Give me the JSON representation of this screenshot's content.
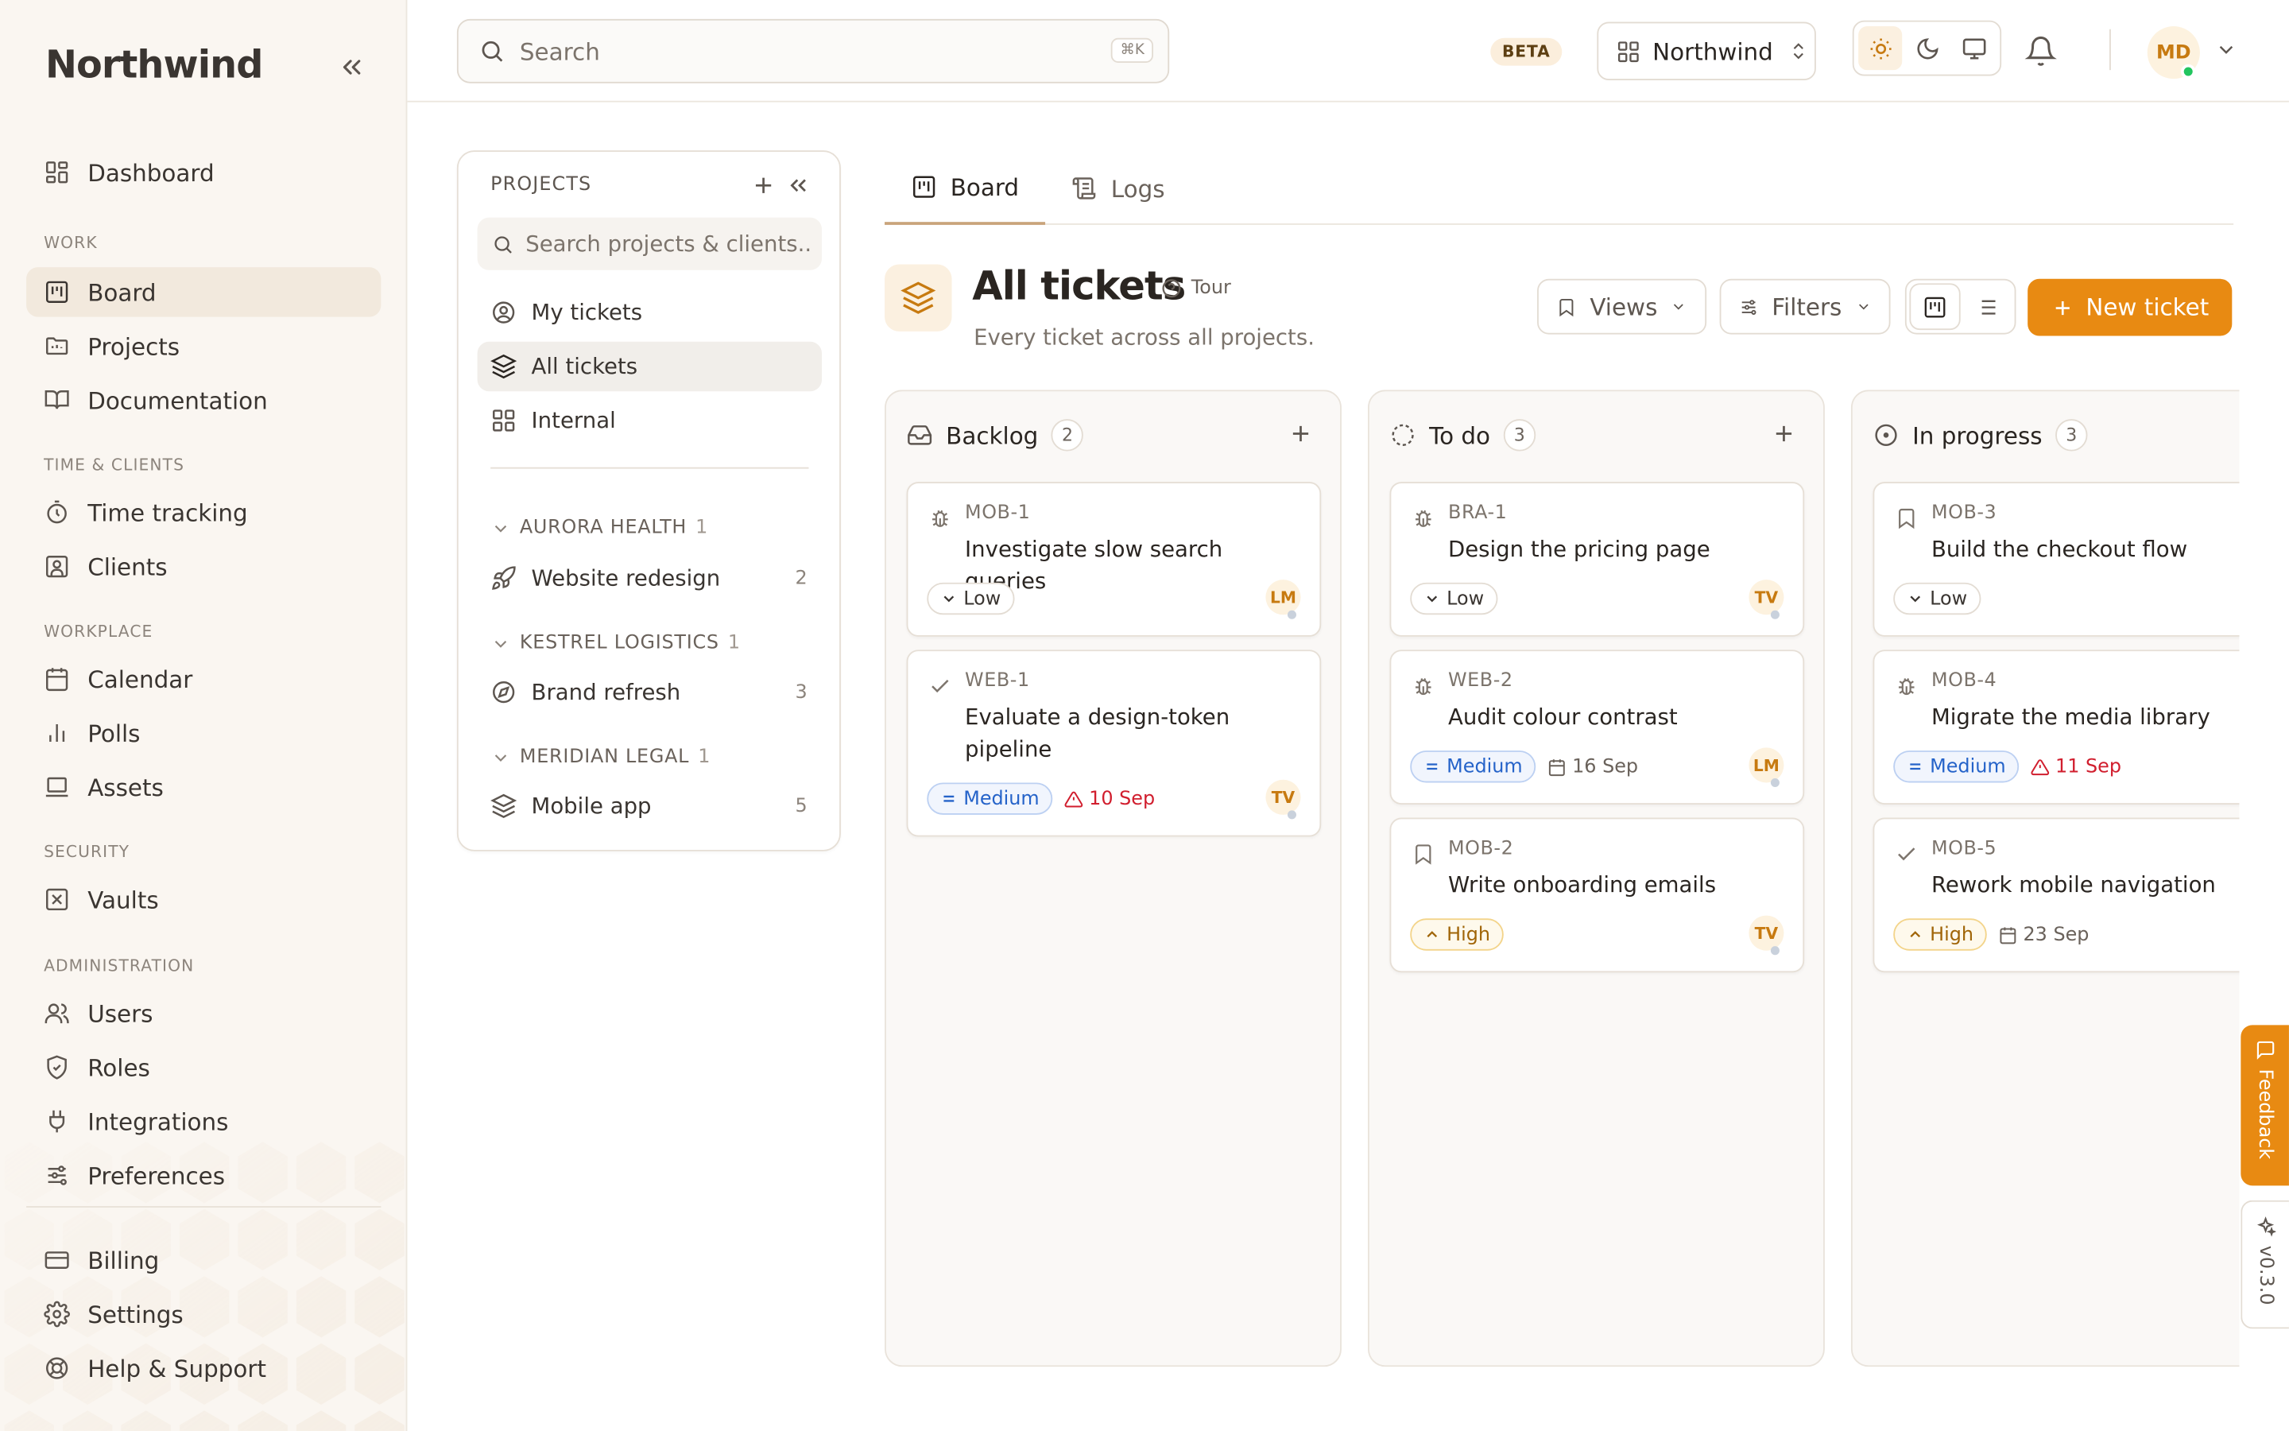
{
  "sidebar": {
    "brand": "Northwind",
    "items": {
      "dashboard": "Dashboard",
      "board": "Board",
      "projects": "Projects",
      "documentation": "Documentation",
      "time_tracking": "Time tracking",
      "clients": "Clients",
      "calendar": "Calendar",
      "polls": "Polls",
      "assets": "Assets",
      "vaults": "Vaults",
      "users": "Users",
      "roles": "Roles",
      "integrations": "Integrations",
      "preferences": "Preferences",
      "billing": "Billing",
      "settings": "Settings",
      "help": "Help & Support"
    },
    "sections": {
      "work": "WORK",
      "time_clients": "TIME & CLIENTS",
      "workplace": "WORKPLACE",
      "security": "SECURITY",
      "administration": "ADMINISTRATION"
    }
  },
  "topbar": {
    "search_placeholder": "Search",
    "search_shortcut": "⌘K",
    "beta": "BETA",
    "workspace": "Northwind",
    "avatar_initials": "MD"
  },
  "projects_panel": {
    "title": "PROJECTS",
    "search_placeholder": "Search projects & clients...",
    "my_tickets": "My tickets",
    "all_tickets": "All tickets",
    "internal": "Internal",
    "clients": [
      {
        "name": "AURORA HEALTH",
        "count": "1",
        "project": "Website redesign",
        "project_count": "2"
      },
      {
        "name": "KESTREL LOGISTICS",
        "count": "1",
        "project": "Brand refresh",
        "project_count": "3"
      },
      {
        "name": "MERIDIAN LEGAL",
        "count": "1",
        "project": "Mobile app",
        "project_count": "5"
      }
    ]
  },
  "main": {
    "tabs": {
      "board": "Board",
      "logs": "Logs"
    },
    "title": "All tickets",
    "tour": "Tour",
    "subtitle": "Every ticket across all projects.",
    "views": "Views",
    "filters": "Filters",
    "new_ticket": "New ticket"
  },
  "board": {
    "columns": [
      {
        "name": "Backlog",
        "count": "2",
        "cards": [
          {
            "id": "MOB-1",
            "title": "Investigate slow search queries",
            "priority": "Low",
            "assignee": "LM"
          },
          {
            "id": "WEB-1",
            "title": "Evaluate a design-token pipeline",
            "priority": "Medium",
            "due": "10 Sep",
            "assignee": "TV"
          }
        ]
      },
      {
        "name": "To do",
        "count": "3",
        "cards": [
          {
            "id": "BRA-1",
            "title": "Design the pricing page",
            "priority": "Low",
            "assignee": "TV"
          },
          {
            "id": "WEB-2",
            "title": "Audit colour contrast",
            "priority": "Medium",
            "due": "16 Sep",
            "assignee": "LM"
          },
          {
            "id": "MOB-2",
            "title": "Write onboarding emails",
            "priority": "High",
            "assignee": "TV"
          }
        ]
      },
      {
        "name": "In progress",
        "count": "3",
        "cards": [
          {
            "id": "MOB-3",
            "title": "Build the checkout flow",
            "priority": "Low"
          },
          {
            "id": "MOB-4",
            "title": "Migrate the media library",
            "priority": "Medium",
            "due": "11 Sep"
          },
          {
            "id": "MOB-5",
            "title": "Rework mobile navigation",
            "priority": "High",
            "due": "23 Sep"
          }
        ]
      }
    ]
  },
  "floating": {
    "feedback": "Feedback",
    "version": "v0.3.0"
  },
  "colors": {
    "accent": "#e88a12",
    "sidebar_bg": "#faf6f1",
    "overdue": "#d11e2e",
    "medium": "#2563c9"
  }
}
